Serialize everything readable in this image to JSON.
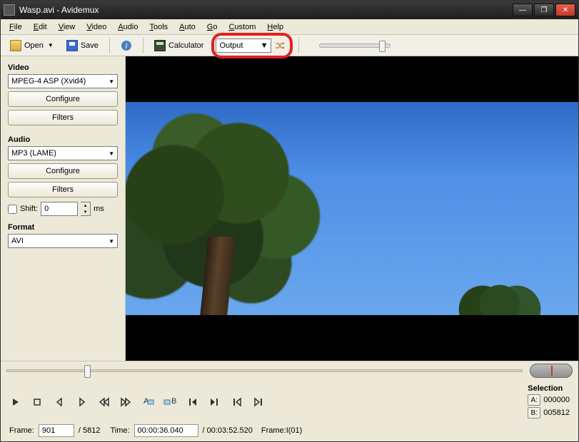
{
  "title": "Wasp.avi - Avidemux",
  "menus": [
    "File",
    "Edit",
    "View",
    "Video",
    "Audio",
    "Tools",
    "Auto",
    "Go",
    "Custom",
    "Help"
  ],
  "toolbar": {
    "open": "Open",
    "save": "Save",
    "calculator": "Calculator",
    "output_selected": "Output"
  },
  "sidebar": {
    "video": {
      "label": "Video",
      "codec": "MPEG-4 ASP (Xvid4)",
      "configure": "Configure",
      "filters": "Filters"
    },
    "audio": {
      "label": "Audio",
      "codec": "MP3 (LAME)",
      "configure": "Configure",
      "filters": "Filters",
      "shift_label": "Shift:",
      "shift_value": "0",
      "shift_unit": "ms"
    },
    "format": {
      "label": "Format",
      "container": "AVI"
    }
  },
  "selection": {
    "label": "Selection",
    "a_label": "A:",
    "a_value": "000000",
    "b_label": "B:",
    "b_value": "005812"
  },
  "status": {
    "frame_label": "Frame:",
    "frame_value": "901",
    "frame_total": "/ 5812",
    "time_label": "Time:",
    "time_value": "00:00:36.040",
    "time_total": "/ 00:03:52.520",
    "frame_type": "Frame:I(01)"
  }
}
